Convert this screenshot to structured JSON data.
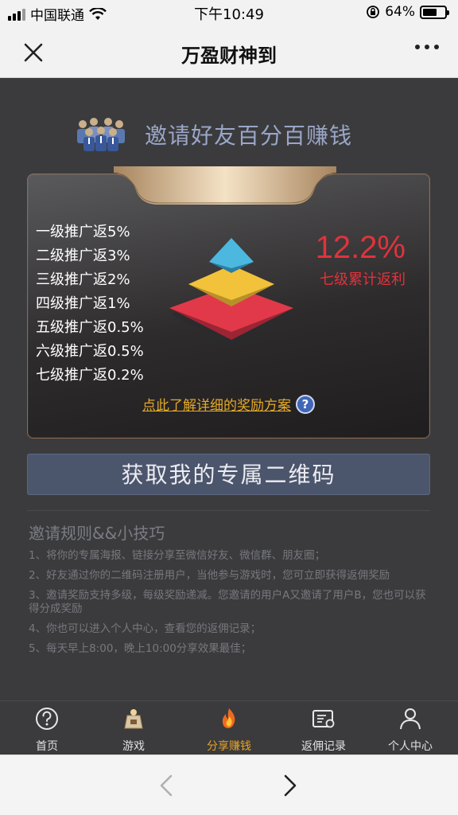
{
  "status_bar": {
    "carrier": "中国联通",
    "time": "下午10:49",
    "battery": "64%",
    "battery_level": 0.64
  },
  "nav": {
    "title": "万盈财神到"
  },
  "invite": {
    "title": "邀请好友百分百赚钱"
  },
  "reward_card": {
    "levels": [
      "一级推广返5%",
      "二级推广返3%",
      "三级推广返2%",
      "四级推广返1%",
      "五级推广返0.5%",
      "六级推广返0.5%",
      "七级推广返0.2%"
    ],
    "total_rate": "12.2%",
    "total_label": "七级累计返利",
    "detail_link": "点此了解详细的奖励方案",
    "accent_red": "#e0333c",
    "accent_gold": "#e3aa29"
  },
  "qr_button": {
    "label": "获取我的专属二维码"
  },
  "rules": {
    "title": "邀请规则&&小技巧",
    "items": [
      "1、将你的专属海报、链接分享至微信好友、微信群、朋友圈；",
      "2、好友通过你的二维码注册用户，当他参与游戏时，您可立即获得返佣奖励",
      "3、邀请奖励支持多级，每级奖励递减。您邀请的用户A又邀请了用户B，您也可以获得分成奖励",
      "4、你也可以进入个人中心，查看您的返佣记录；",
      "5、每天早上8:00，晚上10:00分享效果最佳；"
    ]
  },
  "tabs": [
    {
      "label": "首页",
      "icon": "help-circle-icon"
    },
    {
      "label": "游戏",
      "icon": "game-icon"
    },
    {
      "label": "分享赚钱",
      "icon": "flame-icon",
      "active": true
    },
    {
      "label": "返佣记录",
      "icon": "certificate-icon"
    },
    {
      "label": "个人中心",
      "icon": "user-icon"
    }
  ],
  "active_tab_color": "#e7a327"
}
